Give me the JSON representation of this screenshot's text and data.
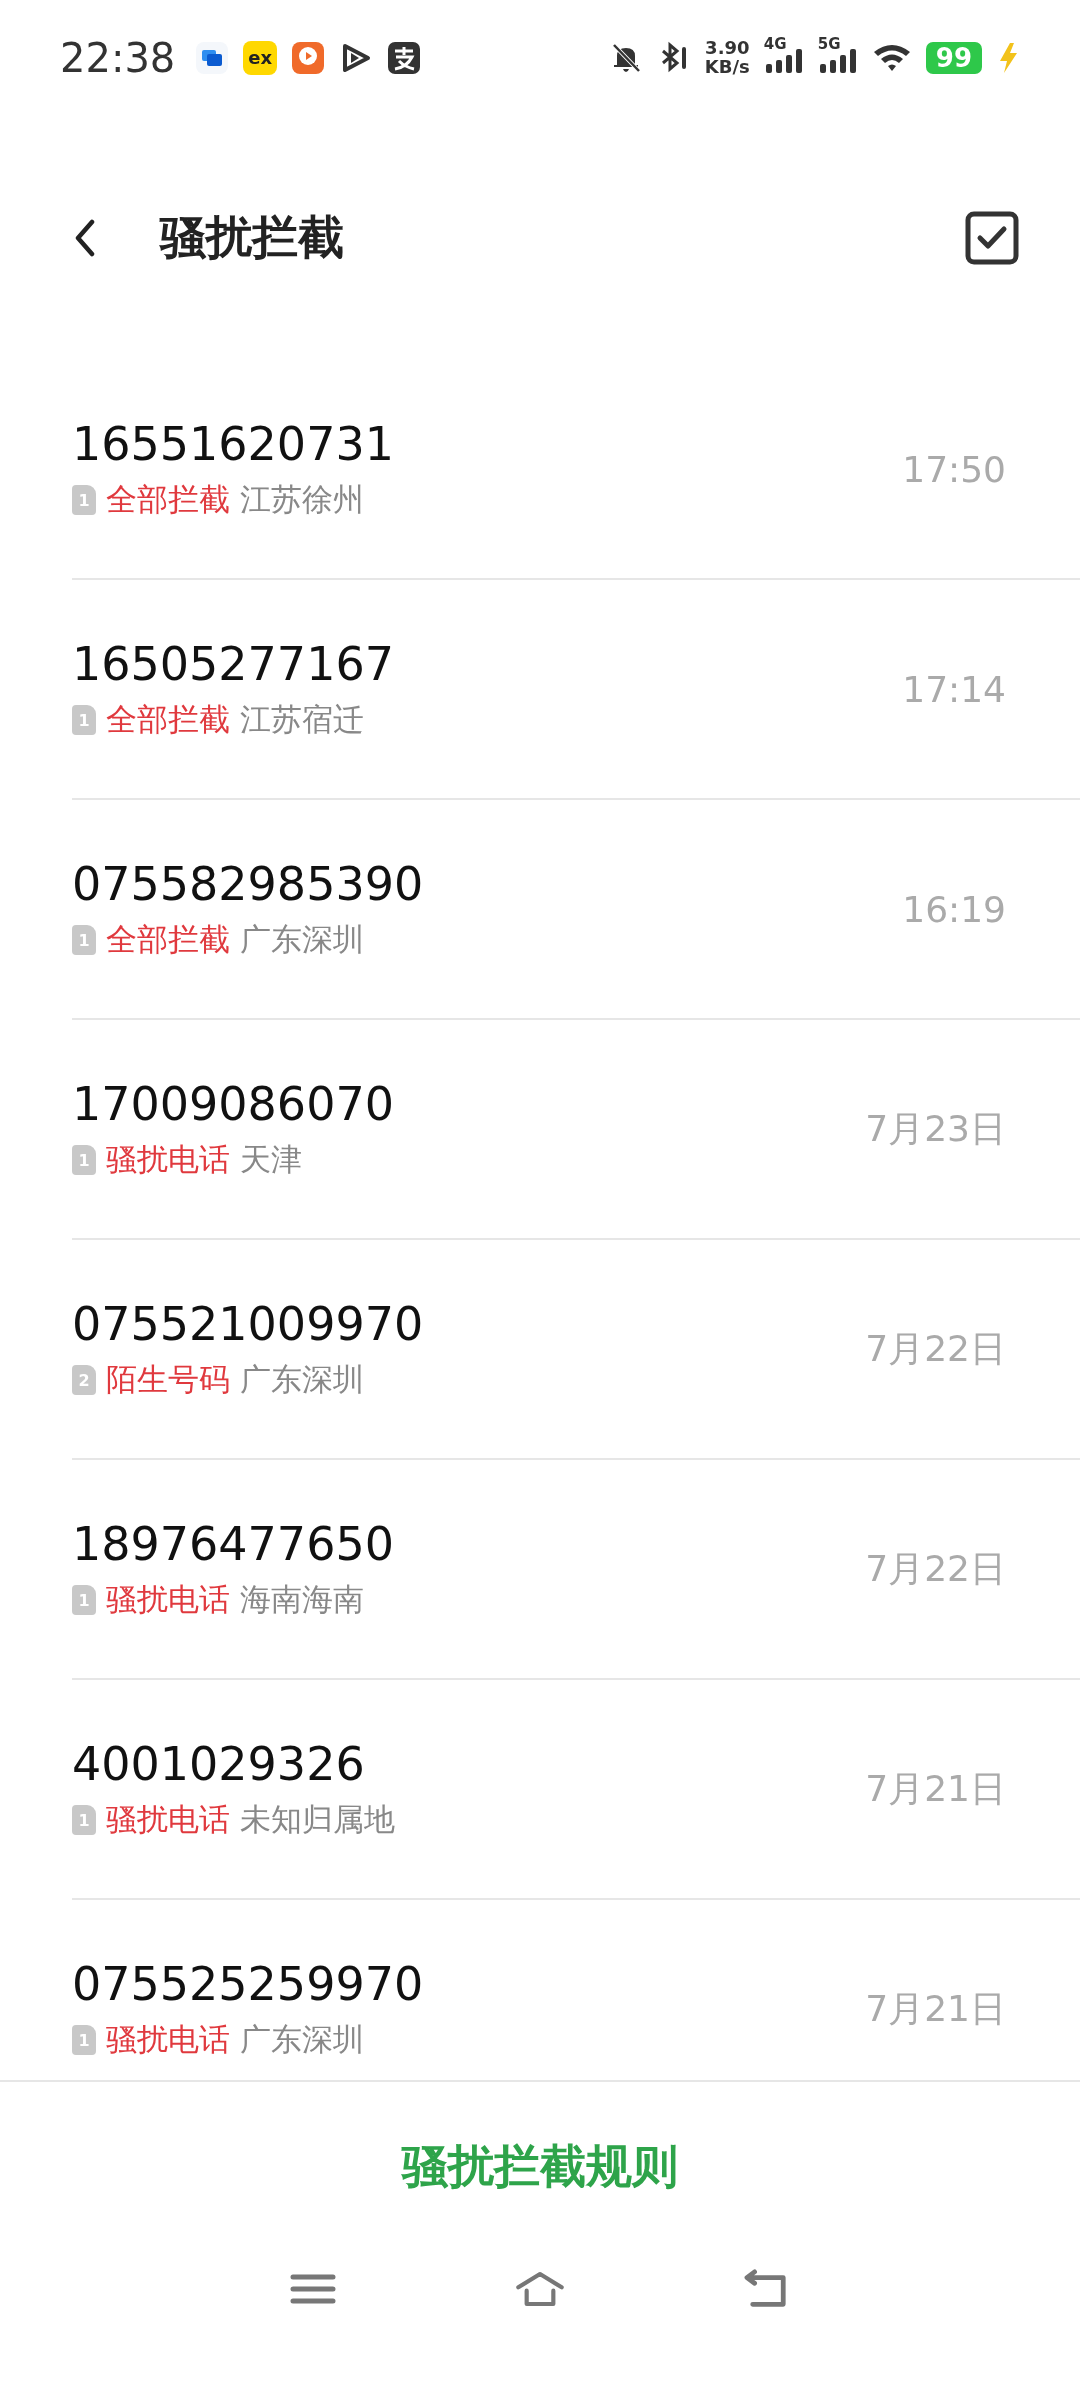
{
  "status_bar": {
    "time": "22:38",
    "app_icons": [
      {
        "kind": "chat"
      },
      {
        "kind": "ex",
        "text": "ex"
      },
      {
        "kind": "video"
      },
      {
        "kind": "play"
      },
      {
        "kind": "pay"
      }
    ],
    "net_speed": [
      "3.90",
      "KB/s"
    ],
    "signals": [
      "4G",
      "5G"
    ],
    "battery": "99",
    "charging": true
  },
  "header": {
    "title": "骚扰拦截"
  },
  "calls": [
    {
      "number": "16551620731",
      "sim": "1",
      "tag": "全部拦截",
      "location": "江苏徐州",
      "time": "17:50"
    },
    {
      "number": "16505277167",
      "sim": "1",
      "tag": "全部拦截",
      "location": "江苏宿迁",
      "time": "17:14"
    },
    {
      "number": "075582985390",
      "sim": "1",
      "tag": "全部拦截",
      "location": "广东深圳",
      "time": "16:19"
    },
    {
      "number": "17009086070",
      "sim": "1",
      "tag": "骚扰电话",
      "location": "天津",
      "time": "7月23日"
    },
    {
      "number": "075521009970",
      "sim": "2",
      "tag": "陌生号码",
      "location": "广东深圳",
      "time": "7月22日"
    },
    {
      "number": "18976477650",
      "sim": "1",
      "tag": "骚扰电话",
      "location": "海南海南",
      "time": "7月22日"
    },
    {
      "number": "4001029326",
      "sim": "1",
      "tag": "骚扰电话",
      "location": "未知归属地",
      "time": "7月21日"
    },
    {
      "number": "075525259970",
      "sim": "1",
      "tag": "骚扰电话",
      "location": "广东深圳",
      "time": "7月21日"
    }
  ],
  "rules_button": "骚扰拦截规则"
}
